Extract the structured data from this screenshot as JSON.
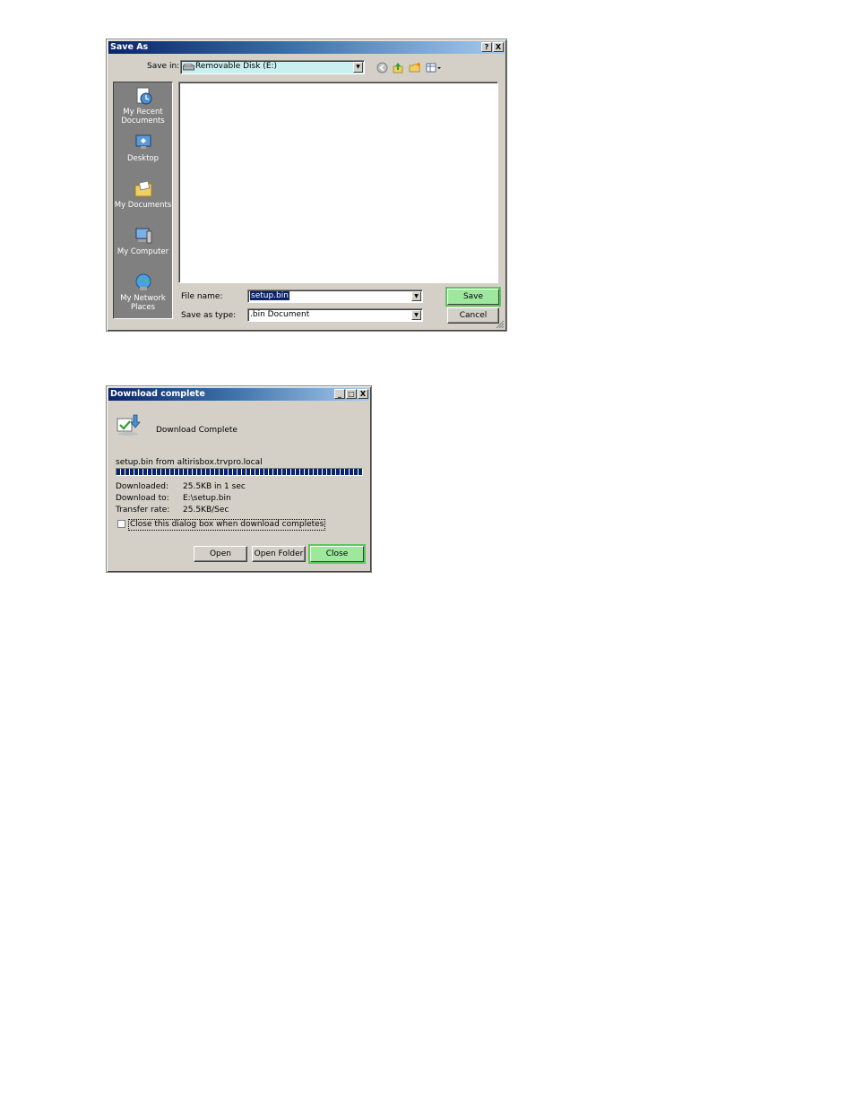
{
  "save_as": {
    "title": "Save As",
    "help_btn": "?",
    "close_btn": "X",
    "save_in_label": "Save in:",
    "save_in_value": "Removable Disk (E:)",
    "places": [
      {
        "label": "My Recent Documents"
      },
      {
        "label": "Desktop"
      },
      {
        "label": "My Documents"
      },
      {
        "label": "My Computer"
      },
      {
        "label": "My Network Places"
      }
    ],
    "file_name_label": "File name:",
    "file_name_value": "setup.bin",
    "save_as_type_label": "Save as type:",
    "save_as_type_value": ".bin Document",
    "save_button": "Save",
    "cancel_button": "Cancel"
  },
  "download": {
    "title": "Download complete",
    "min_btn": "_",
    "max_btn": "□",
    "close_btn": "X",
    "heading": "Download Complete",
    "source": "setup.bin from altirisbox.trvpro.local",
    "progress": 1.0,
    "downloaded_label": "Downloaded:",
    "downloaded_value": "25.5KB in 1 sec",
    "download_to_label": "Download to:",
    "download_to_value": "E:\\setup.bin",
    "transfer_rate_label": "Transfer rate:",
    "transfer_rate_value": "25.5KB/Sec",
    "close_checkbox_label": "Close this dialog box when download completes",
    "open_button": "Open",
    "open_folder_button": "Open Folder",
    "close_button": "Close"
  },
  "colors": {
    "title_active": "#0a246a",
    "highlight_button": "#9ee89e",
    "selection": "#0a246a",
    "save_in_field": "#c8f0f0"
  }
}
